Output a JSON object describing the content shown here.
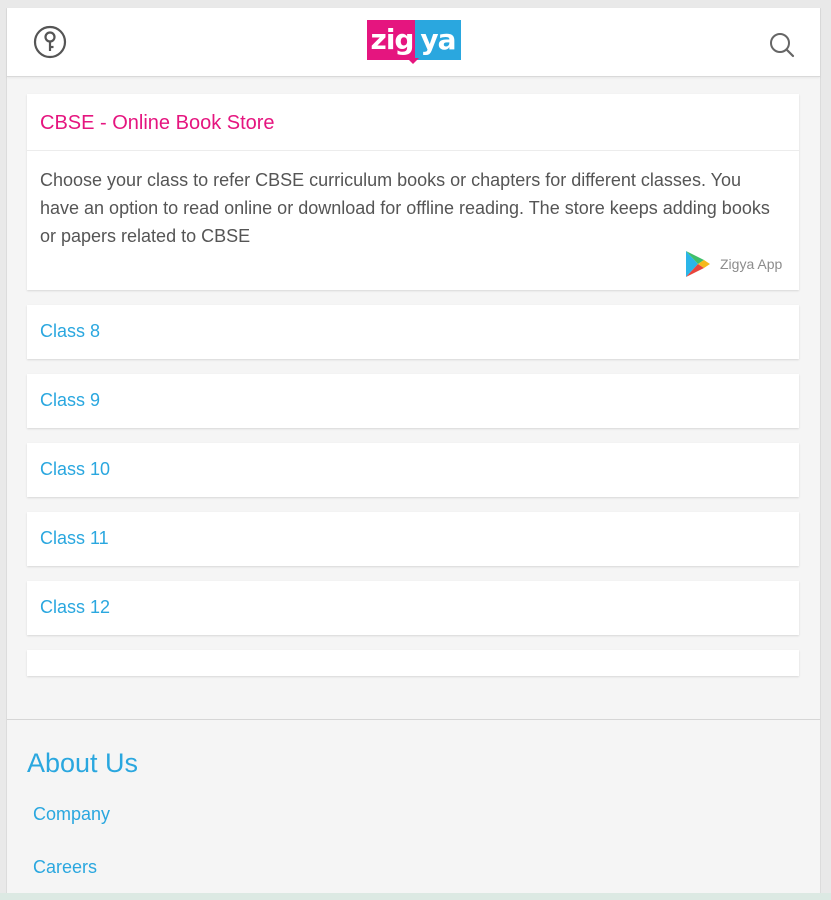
{
  "header": {
    "logo_text_left": "zig",
    "logo_text_right": "ya",
    "icons": {
      "left": "key-icon",
      "right": "search-icon"
    },
    "colors": {
      "pink": "#e5157f",
      "blue": "#2aa7df"
    }
  },
  "info_card": {
    "title": "CBSE - Online Book Store",
    "description": "Choose your class to refer CBSE curriculum books or chapters for different classes. You have an option to read online or download for offline reading. The store keeps adding books or papers related to CBSE",
    "app_link_label": "Zigya App",
    "app_icon": "google-play-icon"
  },
  "classes": [
    {
      "label": "Class 8"
    },
    {
      "label": "Class 9"
    },
    {
      "label": "Class 10"
    },
    {
      "label": "Class 11"
    },
    {
      "label": "Class 12"
    }
  ],
  "footer": {
    "about_title": "About Us",
    "links": [
      {
        "label": "Company"
      },
      {
        "label": "Careers"
      }
    ]
  }
}
